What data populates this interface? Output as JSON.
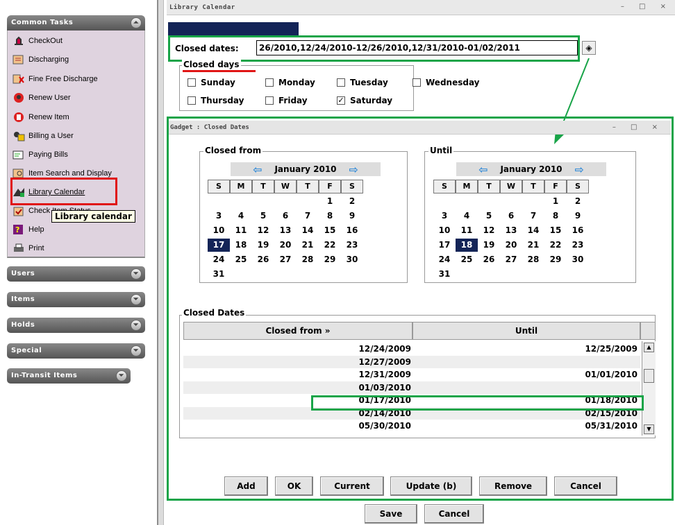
{
  "sidebar": {
    "common_tasks": {
      "title": "Common Tasks",
      "items": [
        {
          "label": "CheckOut",
          "icon": "checkout-icon"
        },
        {
          "label": "Discharging",
          "icon": "discharging-icon"
        },
        {
          "label": "Fine Free Discharge",
          "icon": "fine-free-discharge-icon"
        },
        {
          "label": "Renew User",
          "icon": "renew-user-icon"
        },
        {
          "label": "Renew Item",
          "icon": "renew-item-icon"
        },
        {
          "label": "Billing a User",
          "icon": "billing-icon"
        },
        {
          "label": "Paying Bills",
          "icon": "paying-bills-icon"
        },
        {
          "label": "Item Search and Display",
          "icon": "item-search-icon"
        },
        {
          "label": "Library Calendar",
          "icon": "library-calendar-icon"
        },
        {
          "label": "Check Item Status",
          "icon": "check-item-status-icon"
        },
        {
          "label": "Help",
          "icon": "help-icon"
        },
        {
          "label": "Print",
          "icon": "print-icon"
        }
      ]
    },
    "tooltip": "Library calendar",
    "sections": [
      "Users",
      "Items",
      "Holds",
      "Special",
      "In-Transit Items"
    ]
  },
  "window": {
    "title": "Library Calendar",
    "controls": "– □ ×"
  },
  "closed_dates": {
    "label": "Closed dates:",
    "value": "26/2010,12/24/2010-12/26/2010,12/31/2010-01/02/2011",
    "gadget_button_icon": "diamond-gadget-icon"
  },
  "closed_days": {
    "title": "Closed days",
    "days": [
      {
        "label": "Sunday",
        "checked": false
      },
      {
        "label": "Monday",
        "checked": false
      },
      {
        "label": "Tuesday",
        "checked": false
      },
      {
        "label": "Wednesday",
        "checked": false
      },
      {
        "label": "Thursday",
        "checked": false
      },
      {
        "label": "Friday",
        "checked": false
      },
      {
        "label": "Saturday",
        "checked": true
      }
    ]
  },
  "gadget": {
    "title": "Gadget : Closed Dates",
    "controls": "– □ ×",
    "from_cal": {
      "title": "Closed from",
      "month": "January 2010",
      "selected": "17"
    },
    "until_cal": {
      "title": "Until",
      "month": "January 2010",
      "selected": "18"
    },
    "weekdays": [
      "S",
      "M",
      "T",
      "W",
      "T",
      "F",
      "S"
    ],
    "weeks": [
      [
        "",
        "",
        "",
        "",
        "",
        "1",
        "2"
      ],
      [
        "3",
        "4",
        "5",
        "6",
        "7",
        "8",
        "9"
      ],
      [
        "10",
        "11",
        "12",
        "13",
        "14",
        "15",
        "16"
      ],
      [
        "17",
        "18",
        "19",
        "20",
        "21",
        "22",
        "23"
      ],
      [
        "24",
        "25",
        "26",
        "27",
        "28",
        "29",
        "30"
      ],
      [
        "31",
        "",
        "",
        "",
        "",
        "",
        ""
      ]
    ],
    "table": {
      "title": "Closed Dates",
      "columns": [
        "Closed from »",
        "Until"
      ],
      "rows": [
        [
          "12/24/2009",
          "12/25/2009"
        ],
        [
          "12/27/2009",
          ""
        ],
        [
          "12/31/2009",
          "01/01/2010"
        ],
        [
          "01/03/2010",
          ""
        ],
        [
          "01/17/2010",
          "01/18/2010"
        ],
        [
          "02/14/2010",
          "02/15/2010"
        ],
        [
          "05/30/2010",
          "05/31/2010"
        ]
      ]
    },
    "buttons": {
      "add": "Add",
      "ok": "OK",
      "current": "Current",
      "update": "Update (b)",
      "remove": "Remove",
      "cancel": "Cancel"
    }
  },
  "footer": {
    "save": "Save",
    "cancel": "Cancel"
  },
  "colors": {
    "highlight_green": "#18a448",
    "highlight_red": "#e01515",
    "selected_navy": "#132457"
  }
}
